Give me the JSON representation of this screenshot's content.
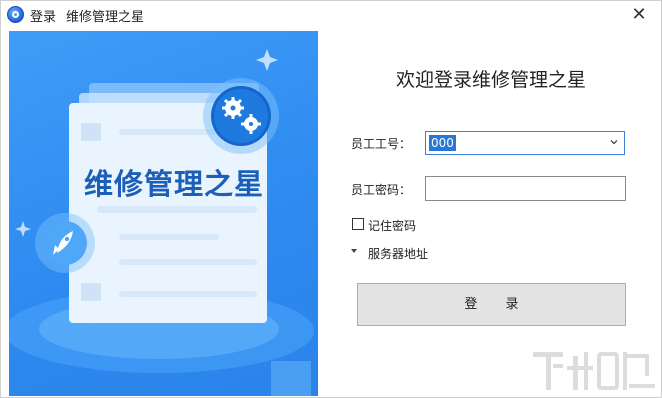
{
  "window": {
    "title_part1": "登录",
    "title_part2": "维修管理之星",
    "close_glyph": "✕",
    "app_icon": "app-logo-icon"
  },
  "banner": {
    "product_name": "维修管理之星",
    "gear_badge_icon": "gears-icon",
    "rocket_badge_icon": "rocket-icon",
    "sparkle_icon": "sparkle-icon",
    "accent_color": "#2e8bf0"
  },
  "login": {
    "welcome": "欢迎登录维修管理之星",
    "employee_id_label": "员工工号：",
    "employee_id_value": "000",
    "password_label": "员工密码：",
    "password_value": "",
    "remember_label": "记住密码",
    "remember_checked": false,
    "server_label": "服务器地址",
    "login_button": "登 录"
  },
  "watermark": {
    "text": "下载吧"
  }
}
